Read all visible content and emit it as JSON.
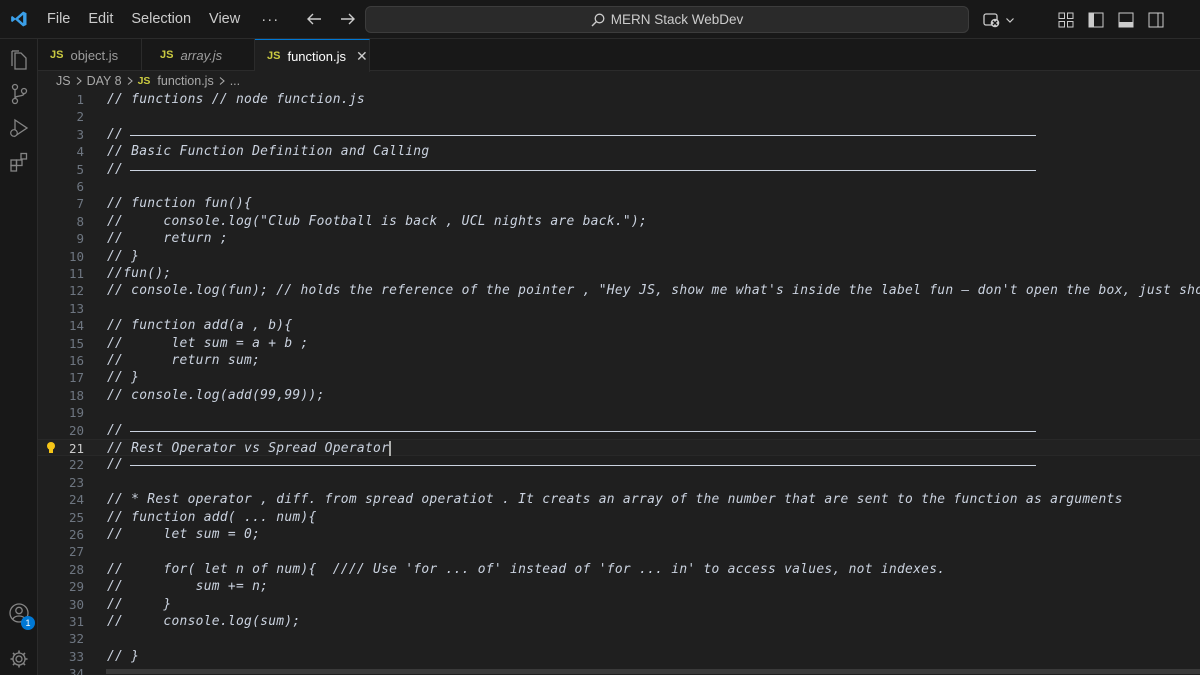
{
  "titlebar": {
    "menus": [
      "File",
      "Edit",
      "Selection",
      "View",
      "···"
    ],
    "search_label": "MERN Stack WebDev"
  },
  "activity": {
    "account_badge": "1"
  },
  "tabs": [
    {
      "icon": "JS",
      "label": "object.js",
      "preview": false,
      "active": false
    },
    {
      "icon": "JS",
      "label": "array.js",
      "preview": true,
      "active": false
    },
    {
      "icon": "JS",
      "label": "function.js",
      "preview": false,
      "active": true,
      "close": "✕"
    }
  ],
  "breadcrumb": {
    "folder1": "JS",
    "folder2": "DAY 8",
    "file_icon": "JS",
    "file": "function.js",
    "more": "..."
  },
  "editor": {
    "current_line": 21,
    "lines": [
      {
        "n": "1",
        "text": "// functions // node function.js"
      },
      {
        "n": "2",
        "text": ""
      },
      {
        "n": "3",
        "text": "//",
        "rule": true
      },
      {
        "n": "4",
        "text": "// Basic Function Definition and Calling"
      },
      {
        "n": "5",
        "text": "//",
        "rule": true
      },
      {
        "n": "6",
        "text": ""
      },
      {
        "n": "7",
        "text": "// function fun(){"
      },
      {
        "n": "8",
        "text": "//     console.log(\"Club Football is back , UCL nights are back.\");"
      },
      {
        "n": "9",
        "text": "//     return ;"
      },
      {
        "n": "10",
        "text": "// }"
      },
      {
        "n": "11",
        "text": "//fun();"
      },
      {
        "n": "12",
        "text": "// console.log(fun); // holds the reference of the pointer , \"Hey JS, show me what's inside the label fun — don't open the box, just show me what"
      },
      {
        "n": "13",
        "text": ""
      },
      {
        "n": "14",
        "text": "// function add(a , b){"
      },
      {
        "n": "15",
        "text": "//      let sum = a + b ;"
      },
      {
        "n": "16",
        "text": "//      return sum;"
      },
      {
        "n": "17",
        "text": "// }"
      },
      {
        "n": "18",
        "text": "// console.log(add(99,99));"
      },
      {
        "n": "19",
        "text": ""
      },
      {
        "n": "20",
        "text": "//",
        "rule": true
      },
      {
        "n": "21",
        "text": "// Rest Operator vs Spread Operator"
      },
      {
        "n": "22",
        "text": "//",
        "rule": true
      },
      {
        "n": "23",
        "text": ""
      },
      {
        "n": "24",
        "text": "// * Rest operator , diff. from spread operatiot . It creats an array of the number that are sent to the function as arguments"
      },
      {
        "n": "25",
        "text": "// function add( ... num){"
      },
      {
        "n": "26",
        "text": "//     let sum = 0;"
      },
      {
        "n": "27",
        "text": ""
      },
      {
        "n": "28",
        "text": "//     for( let n of num){  //// Use 'for ... of' instead of 'for ... in' to access values, not indexes."
      },
      {
        "n": "29",
        "text": "//         sum += n;"
      },
      {
        "n": "30",
        "text": "//     }"
      },
      {
        "n": "31",
        "text": "//     console.log(sum);"
      },
      {
        "n": "32",
        "text": ""
      },
      {
        "n": "33",
        "text": "// }"
      },
      {
        "n": "34",
        "text": ""
      }
    ]
  }
}
